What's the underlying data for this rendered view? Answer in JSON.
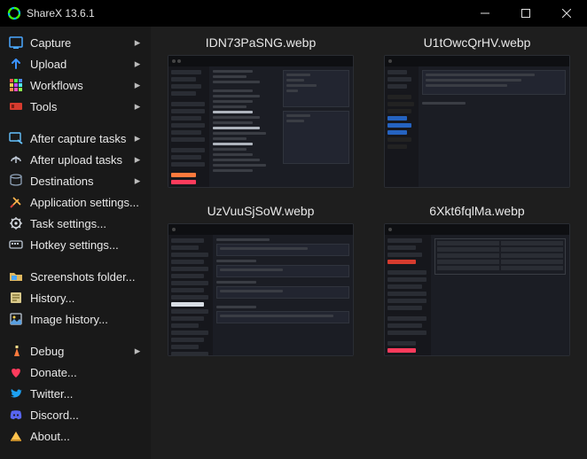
{
  "window": {
    "title": "ShareX 13.6.1"
  },
  "sidebar": {
    "groups": [
      [
        {
          "id": "capture",
          "label": "Capture",
          "icon": "capture-icon",
          "submenu": true
        },
        {
          "id": "upload",
          "label": "Upload",
          "icon": "upload-icon",
          "submenu": true
        },
        {
          "id": "workflows",
          "label": "Workflows",
          "icon": "workflows-icon",
          "submenu": true
        },
        {
          "id": "tools",
          "label": "Tools",
          "icon": "tools-icon",
          "submenu": true
        }
      ],
      [
        {
          "id": "after-capture",
          "label": "After capture tasks",
          "icon": "after-capture-icon",
          "submenu": true
        },
        {
          "id": "after-upload",
          "label": "After upload tasks",
          "icon": "after-upload-icon",
          "submenu": true
        },
        {
          "id": "destinations",
          "label": "Destinations",
          "icon": "destinations-icon",
          "submenu": true
        },
        {
          "id": "app-settings",
          "label": "Application settings...",
          "icon": "app-settings-icon",
          "submenu": false
        },
        {
          "id": "task-settings",
          "label": "Task settings...",
          "icon": "task-settings-icon",
          "submenu": false
        },
        {
          "id": "hotkey-settings",
          "label": "Hotkey settings...",
          "icon": "hotkey-settings-icon",
          "submenu": false
        }
      ],
      [
        {
          "id": "screenshots-folder",
          "label": "Screenshots folder...",
          "icon": "screenshots-folder-icon",
          "submenu": false
        },
        {
          "id": "history",
          "label": "History...",
          "icon": "history-icon",
          "submenu": false
        },
        {
          "id": "image-history",
          "label": "Image history...",
          "icon": "image-history-icon",
          "submenu": false
        }
      ],
      [
        {
          "id": "debug",
          "label": "Debug",
          "icon": "debug-icon",
          "submenu": true
        },
        {
          "id": "donate",
          "label": "Donate...",
          "icon": "donate-icon",
          "submenu": false
        },
        {
          "id": "twitter",
          "label": "Twitter...",
          "icon": "twitter-icon",
          "submenu": false
        },
        {
          "id": "discord",
          "label": "Discord...",
          "icon": "discord-icon",
          "submenu": false
        },
        {
          "id": "about",
          "label": "About...",
          "icon": "about-icon",
          "submenu": false
        }
      ]
    ]
  },
  "thumbnails": [
    {
      "filename": "IDN73PaSNG.webp"
    },
    {
      "filename": "U1tOwcQrHV.webp"
    },
    {
      "filename": "UzVuuSjSoW.webp"
    },
    {
      "filename": "6Xkt6fqlMa.webp"
    }
  ]
}
